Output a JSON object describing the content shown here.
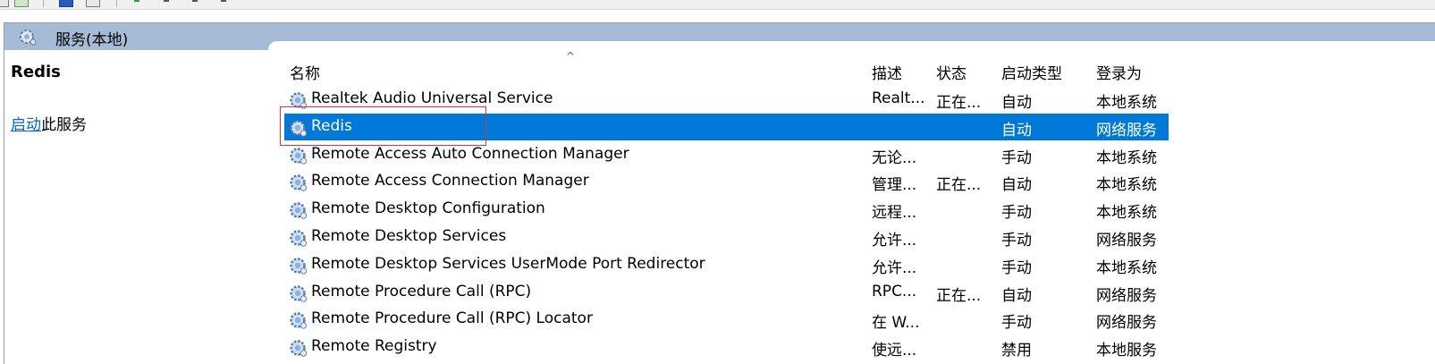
{
  "banner": {
    "title": "服务(本地)",
    "icon": "services-gear-icon"
  },
  "left_pane": {
    "service_name": "Redis",
    "action_link": "启动",
    "action_suffix": "此服务"
  },
  "table": {
    "columns": [
      "名称",
      "描述",
      "状态",
      "启动类型",
      "登录为"
    ],
    "selected_index": 1,
    "rows": [
      {
        "name": "Realtek Audio Universal Service",
        "desc": "Realt...",
        "status": "正在...",
        "startup": "自动",
        "login": "本地系统"
      },
      {
        "name": "Redis",
        "desc": "",
        "status": "",
        "startup": "自动",
        "login": "网络服务"
      },
      {
        "name": "Remote Access Auto Connection Manager",
        "desc": "无论...",
        "status": "",
        "startup": "手动",
        "login": "本地系统"
      },
      {
        "name": "Remote Access Connection Manager",
        "desc": "管理...",
        "status": "正在...",
        "startup": "自动",
        "login": "本地系统"
      },
      {
        "name": "Remote Desktop Configuration",
        "desc": "远程...",
        "status": "",
        "startup": "手动",
        "login": "本地系统"
      },
      {
        "name": "Remote Desktop Services",
        "desc": "允许...",
        "status": "",
        "startup": "手动",
        "login": "网络服务"
      },
      {
        "name": "Remote Desktop Services UserMode Port Redirector",
        "desc": "允许...",
        "status": "",
        "startup": "手动",
        "login": "本地系统"
      },
      {
        "name": "Remote Procedure Call (RPC)",
        "desc": "RPC...",
        "status": "正在...",
        "startup": "自动",
        "login": "网络服务"
      },
      {
        "name": "Remote Procedure Call (RPC) Locator",
        "desc": "在 W...",
        "status": "",
        "startup": "手动",
        "login": "网络服务"
      },
      {
        "name": "Remote Registry",
        "desc": "使远...",
        "status": "",
        "startup": "禁用",
        "login": "本地服务"
      }
    ]
  },
  "colors": {
    "banner": "#a6bbd6",
    "selection": "#0078d7",
    "highlight": "#e0303a",
    "link": "#0066cc"
  }
}
